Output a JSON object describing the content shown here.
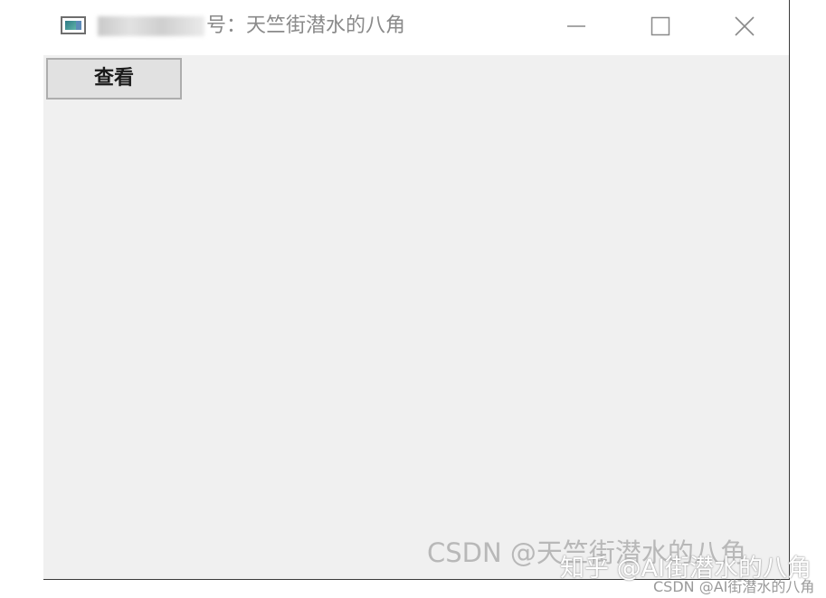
{
  "window": {
    "title_visible": "号：天竺街潜水的八角",
    "minimize_label": "—",
    "maximize_label": "□",
    "close_label": "✕"
  },
  "toolbar": {
    "view_button_label": "查看"
  },
  "watermarks": {
    "csdn_large": "CSDN @天竺街潜水的八角",
    "zhihu": "知乎 @AI街潜水的八角",
    "csdn_small": "CSDN @AI街潜水的八角"
  },
  "icons": {
    "app": "app-window-icon",
    "minimize": "minimize-icon",
    "maximize": "maximize-icon",
    "close": "close-icon"
  }
}
